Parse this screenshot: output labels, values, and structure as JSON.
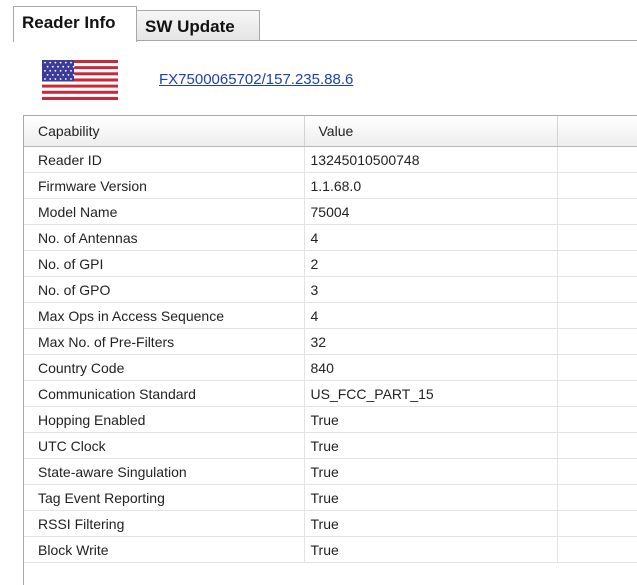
{
  "tabs": [
    {
      "label": "Reader Info",
      "active": true
    },
    {
      "label": "SW Update",
      "active": false
    }
  ],
  "header": {
    "flag_icon": "us-flag-icon",
    "reader_link": "FX7500065702/157.235.88.6"
  },
  "grid": {
    "columns": [
      "Capability",
      "Value"
    ],
    "rows": [
      {
        "capability": "Reader ID",
        "value": "13245010500748"
      },
      {
        "capability": "Firmware Version",
        "value": "1.1.68.0"
      },
      {
        "capability": "Model Name",
        "value": "75004"
      },
      {
        "capability": "No. of Antennas",
        "value": "4"
      },
      {
        "capability": "No. of GPI",
        "value": "2"
      },
      {
        "capability": "No. of GPO",
        "value": "3"
      },
      {
        "capability": "Max Ops in Access Sequence",
        "value": "4"
      },
      {
        "capability": "Max No. of Pre-Filters",
        "value": "32"
      },
      {
        "capability": "Country Code",
        "value": "840"
      },
      {
        "capability": "Communication Standard",
        "value": "US_FCC_PART_15"
      },
      {
        "capability": "Hopping Enabled",
        "value": "True"
      },
      {
        "capability": "UTC Clock",
        "value": "True"
      },
      {
        "capability": "State-aware Singulation",
        "value": "True"
      },
      {
        "capability": "Tag Event Reporting",
        "value": "True"
      },
      {
        "capability": "RSSI Filtering",
        "value": "True"
      },
      {
        "capability": "Block Write",
        "value": "True"
      }
    ]
  },
  "colors": {
    "link": "#1c3fb4",
    "border": "#a8a8a8",
    "flag_red": "#c8283c",
    "flag_blue": "#3c3b9a"
  }
}
